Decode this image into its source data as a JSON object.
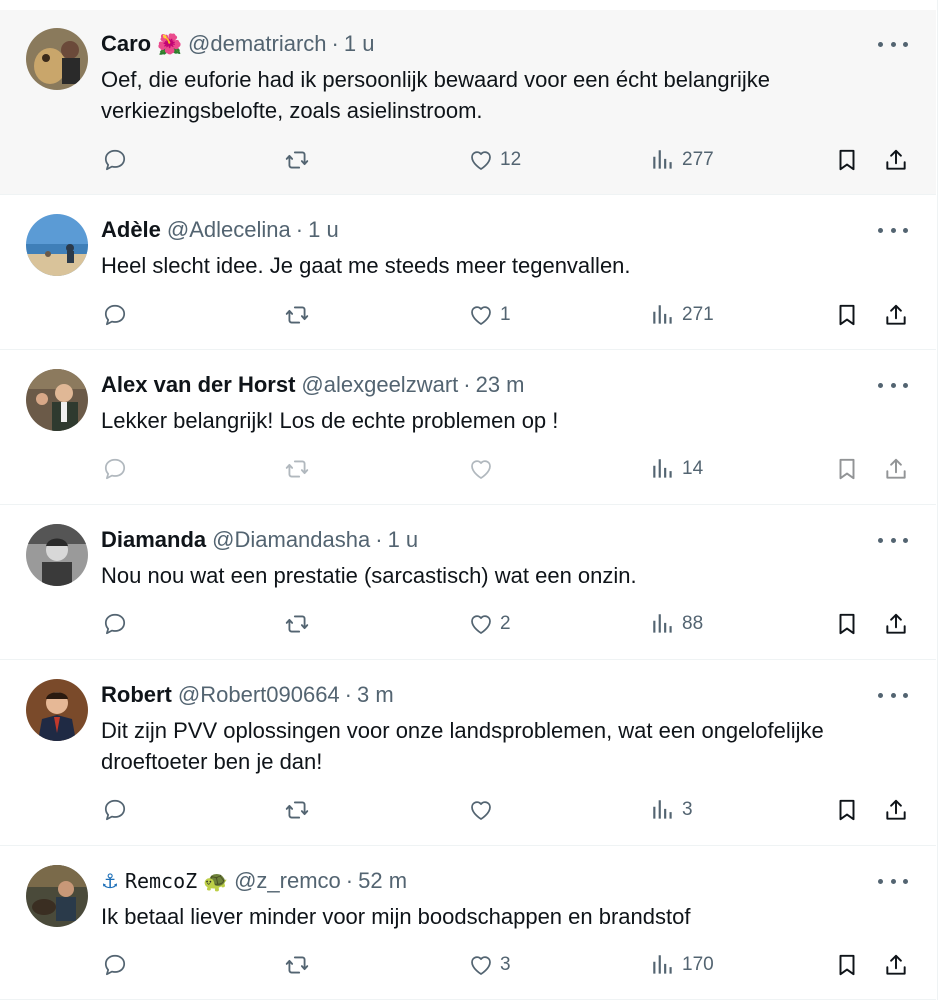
{
  "colors": {
    "secondary": "#536471",
    "text": "#0f1419",
    "highlight_bg": "#f7f7f7",
    "divider": "#eff3f4"
  },
  "tweets": [
    {
      "name": "Caro",
      "name_emoji": "🌺",
      "handle": "@dematriarch",
      "separator": "·",
      "time": "1 u",
      "text": "Oef, die euforie had ik persoonlijk bewaard voor een écht belangrijke verkiezingsbelofte, zoals asielinstroom.",
      "replies": "",
      "retweets": "",
      "likes": "12",
      "views": "277",
      "highlighted": true,
      "avatar_icon": "avatar-photo"
    },
    {
      "name": "Adèle",
      "handle": "@Adlecelina",
      "separator": "·",
      "time": "1 u",
      "text": "Heel slecht idee. Je gaat me steeds meer tegenvallen.",
      "replies": "",
      "retweets": "",
      "likes": "1",
      "views": "271",
      "avatar_icon": "avatar-photo"
    },
    {
      "name": "Alex van der Horst",
      "handle": "@alexgeelzwart",
      "separator": "·",
      "time": "23 m",
      "text": "Lekker belangrijk! Los de echte problemen op !",
      "replies": "",
      "retweets": "",
      "likes": "",
      "views": "14",
      "avatar_icon": "avatar-photo"
    },
    {
      "name": "Diamanda",
      "handle": "@Diamandasha",
      "separator": "·",
      "time": "1 u",
      "text": "Nou nou wat een prestatie (sarcastisch) wat een onzin.",
      "replies": "",
      "retweets": "",
      "likes": "2",
      "views": "88",
      "avatar_icon": "avatar-photo"
    },
    {
      "name": "Robert",
      "handle": "@Robert090664",
      "separator": "·",
      "time": "3 m",
      "text": "Dit zijn PVV oplossingen voor onze landsproblemen, wat een ongelofelijke droeftoeter ben je dan!",
      "replies": "",
      "retweets": "",
      "likes": "",
      "views": "3",
      "avatar_icon": "avatar-photo"
    },
    {
      "name_prefix_emoji": "⚓",
      "name": "RemcoZ",
      "name_emoji": "🐢",
      "handle": "@z_remco",
      "separator": "·",
      "time": "52 m",
      "text": "Ik betaal liever minder voor mijn boodschappen en brandstof",
      "replies": "",
      "retweets": "",
      "likes": "3",
      "views": "170",
      "avatar_icon": "avatar-photo"
    }
  ]
}
